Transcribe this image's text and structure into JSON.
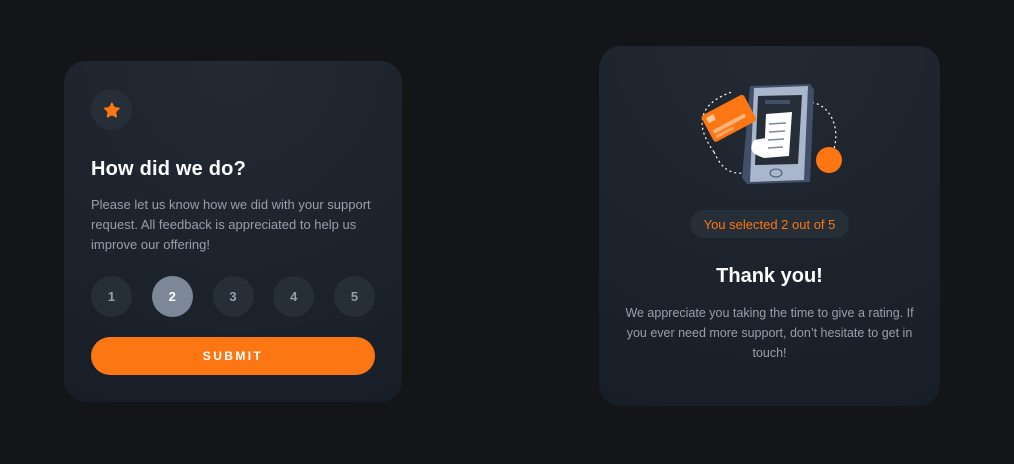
{
  "rating_card": {
    "title": "How did we do?",
    "description": "Please let us know how we did with your support request. All feedback is appreciated to help us improve our offering!",
    "ratings": [
      "1",
      "2",
      "3",
      "4",
      "5"
    ],
    "selected_rating": "2",
    "submit_label": "SUBMIT",
    "icon": "star-icon"
  },
  "thank_you_card": {
    "selected_text": "You selected 2 out of 5",
    "title": "Thank you!",
    "description": "We appreciate you taking the time to give a rating. If you ever need more support, don’t hesitate to get in touch!",
    "illustration": "payment-phone-illustration"
  },
  "colors": {
    "background": "#131518",
    "card": "#1f2630",
    "accent": "#fc7614",
    "muted_text": "#969fad",
    "button_bg": "#262e38",
    "selected_bg": "#7c8798"
  }
}
